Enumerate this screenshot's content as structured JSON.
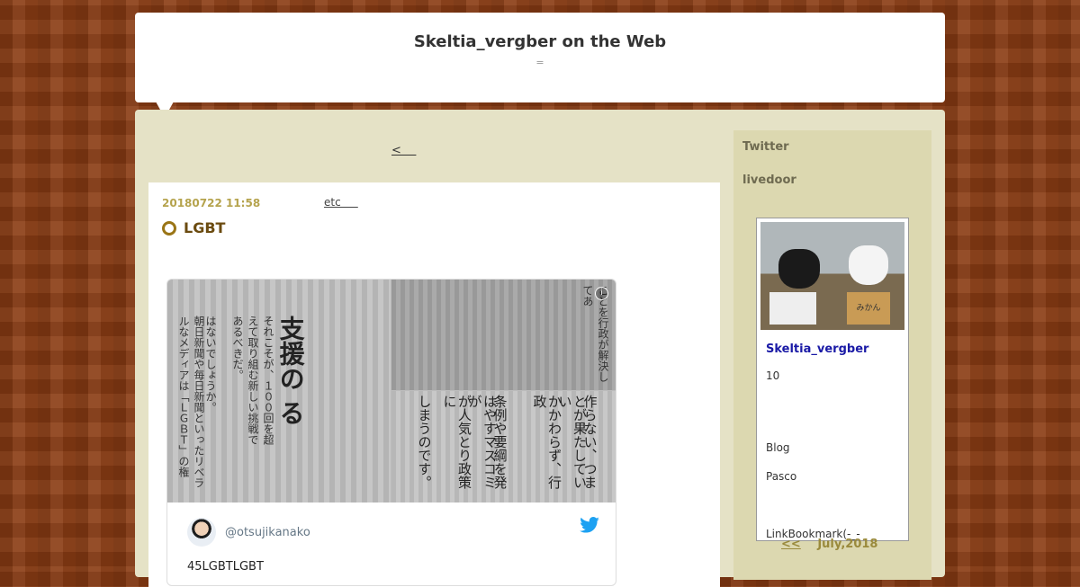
{
  "blog": {
    "title": "Skeltia_vergber on the Web",
    "subtitle": "="
  },
  "nav": {
    "prev_label": "<    "
  },
  "post": {
    "date": "20180722 11:58",
    "category": "etc     ",
    "title": "LGBT",
    "tweet": {
      "handle": "@otsujikanako",
      "text": "45LGBTLGBT",
      "image_text": {
        "big": "支援の\nる",
        "col1": "それこそが、１００回を超えて取り組む新しい挑戦であるべきだ。",
        "col2": "はないでしょうか。",
        "col3": "朝日新聞や毎日新聞といったリベラルなメディアは「ＬＧＢＴ」の権",
        "tr": "ことを行政が解決してあ",
        "br1": "作らない、つま",
        "br2": "とが果たしていい",
        "br3": "かかわらず、行政",
        "br4": "条例や要綱を発",
        "br5": "はやすマスコミが",
        "br6": "が人気とり政策に",
        "br7": "しまうのです。"
      }
    }
  },
  "sidebar": {
    "twitter_label": "Twitter",
    "livedoor_label": "livedoor",
    "profile": {
      "box_label": "みかん",
      "name": "Skeltia_vergber",
      "count": "10",
      "blog": "Blog",
      "pasco": "Pasco",
      "link": "LinkBookmark(-_-"
    },
    "calendar": {
      "prev": "<<",
      "month": "July,2018"
    }
  },
  "icons": {
    "tweet_brand": "twitter-bird-icon",
    "title_marker": "ring-icon",
    "info": "info-icon"
  },
  "colors": {
    "background": "#8a3c14",
    "panel": "#e5e2c6",
    "sidebar": "#dcd8b0",
    "date": "#b5a34d",
    "link": "#1a1aa6",
    "twitter": "#1da1f2"
  }
}
